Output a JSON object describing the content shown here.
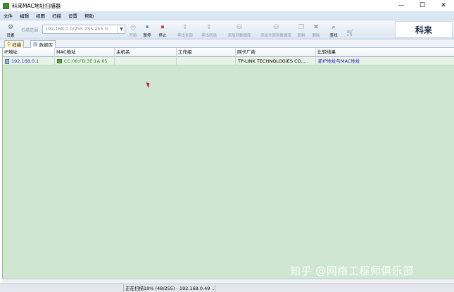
{
  "window": {
    "title": "科来MAC地址扫描器",
    "icon": "app-icon",
    "controls": [
      "—",
      "☐",
      "✕"
    ]
  },
  "menu": [
    "文件",
    "编辑",
    "视图",
    "扫描",
    "设置",
    "帮助"
  ],
  "toolbar": {
    "settings_label": "设置",
    "scan_range_label": "扫描范围",
    "scan_range_value": "192.168.0.0/255.255.255.0",
    "start_label": "开始",
    "pause_label": "暂停",
    "stop_label": "停止",
    "export_all_label": "导出全部",
    "export_selected_label": "导出所选",
    "add_to_db_label": "添加到数据库",
    "add_all_to_db_label": "添加全部到数据库",
    "copy_label": "复制",
    "delete_label": "删除",
    "find_label": "查找",
    "logo_text": "科来"
  },
  "tabs": [
    "扫描",
    "数据库"
  ],
  "table": {
    "columns": [
      "IP地址",
      "MAC地址",
      "主机名",
      "工作组",
      "网卡厂商",
      "比较结果"
    ],
    "rows": [
      {
        "ip": "192.168.0.1",
        "mac": "CC:08:FB:3E:1A:85",
        "host": "",
        "workgroup": "",
        "vendor": "TP-LINK TECHNOLOGIES CO.,...",
        "result": "新IP地址与MAC地址"
      }
    ]
  },
  "status": {
    "progress_text": "正在扫描19% (48/255) - 192.168.0.49 ..."
  },
  "watermark": "知乎 @网络工程师俱乐部",
  "colors": {
    "grid_background": "#cfe6d0",
    "ip_text": "#2a2ac0",
    "mac_text": "#3a8a2a",
    "result_text": "#2020b0"
  }
}
